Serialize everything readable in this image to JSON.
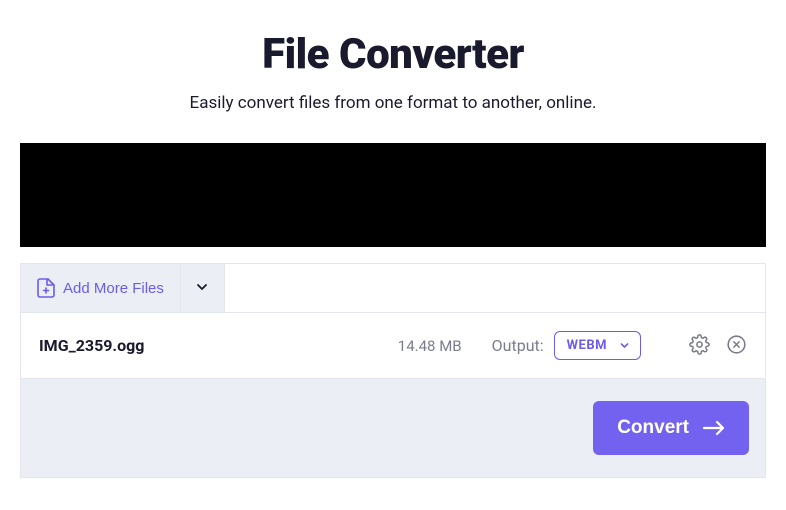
{
  "header": {
    "title": "File Converter",
    "subtitle": "Easily convert files from one format to another, online."
  },
  "toolbar": {
    "add_more_label": "Add More Files"
  },
  "file": {
    "name": "IMG_2359.ogg",
    "size": "14.48 MB",
    "output_label": "Output:",
    "format": "WEBM"
  },
  "actions": {
    "convert_label": "Convert"
  }
}
